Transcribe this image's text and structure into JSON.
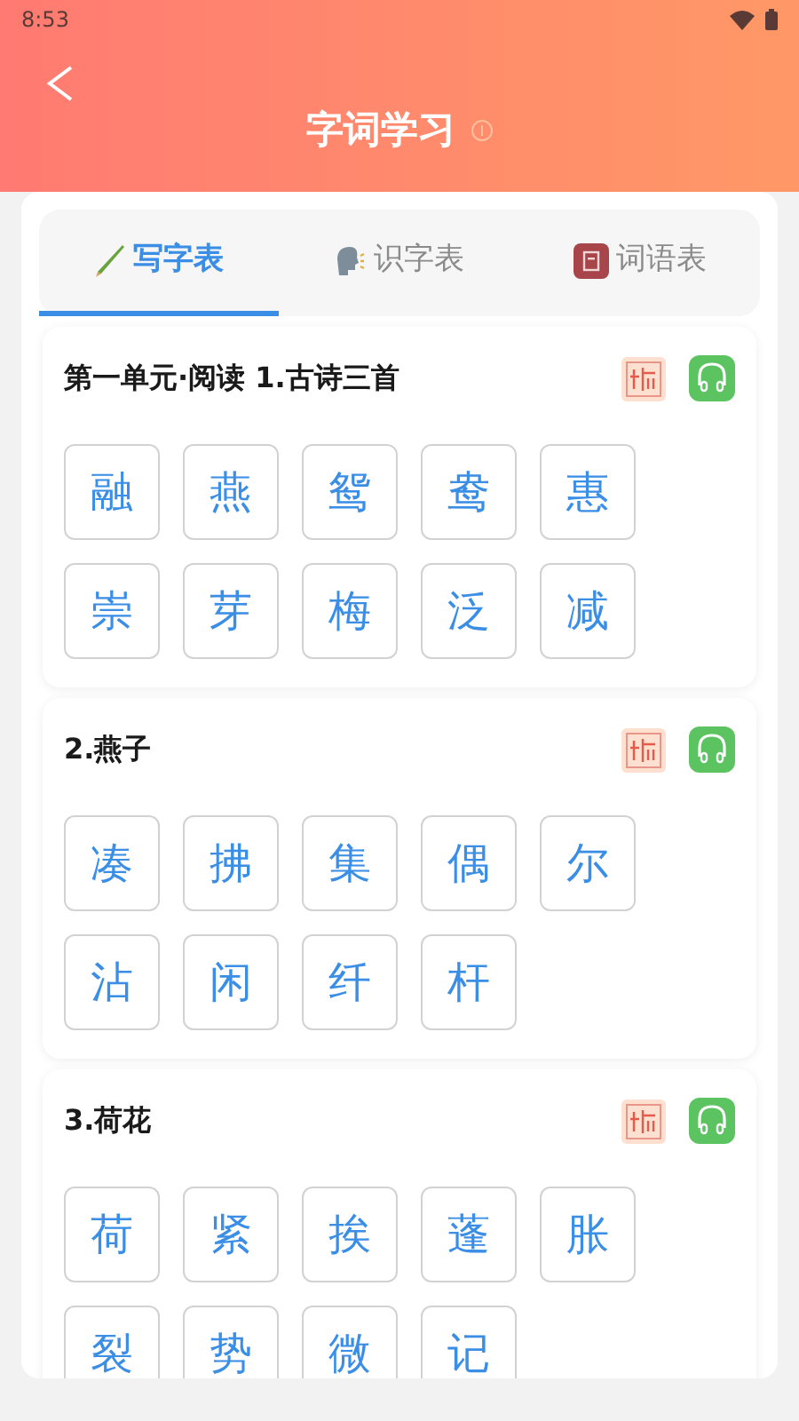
{
  "status_bar": {
    "time": "8:53"
  },
  "header": {
    "title": "字词学习"
  },
  "tabs": [
    {
      "label": "写字表",
      "kind": "pencil",
      "selected": true
    },
    {
      "label": "识字表",
      "kind": "speak",
      "selected": false
    },
    {
      "label": "词语表",
      "kind": "book",
      "selected": false
    }
  ],
  "sections": [
    {
      "title": "第一单元·阅读 1.古诗三首",
      "characters": [
        "融",
        "燕",
        "鸳",
        "鸯",
        "惠",
        "崇",
        "芽",
        "梅",
        "泛",
        "减"
      ]
    },
    {
      "title": "2.燕子",
      "characters": [
        "凑",
        "拂",
        "集",
        "偶",
        "尔",
        "沾",
        "闲",
        "纤",
        "杆"
      ]
    },
    {
      "title": "3.荷花",
      "characters": [
        "荷",
        "紧",
        "挨",
        "蓬",
        "胀",
        "裂",
        "势",
        "微",
        "记"
      ]
    }
  ]
}
